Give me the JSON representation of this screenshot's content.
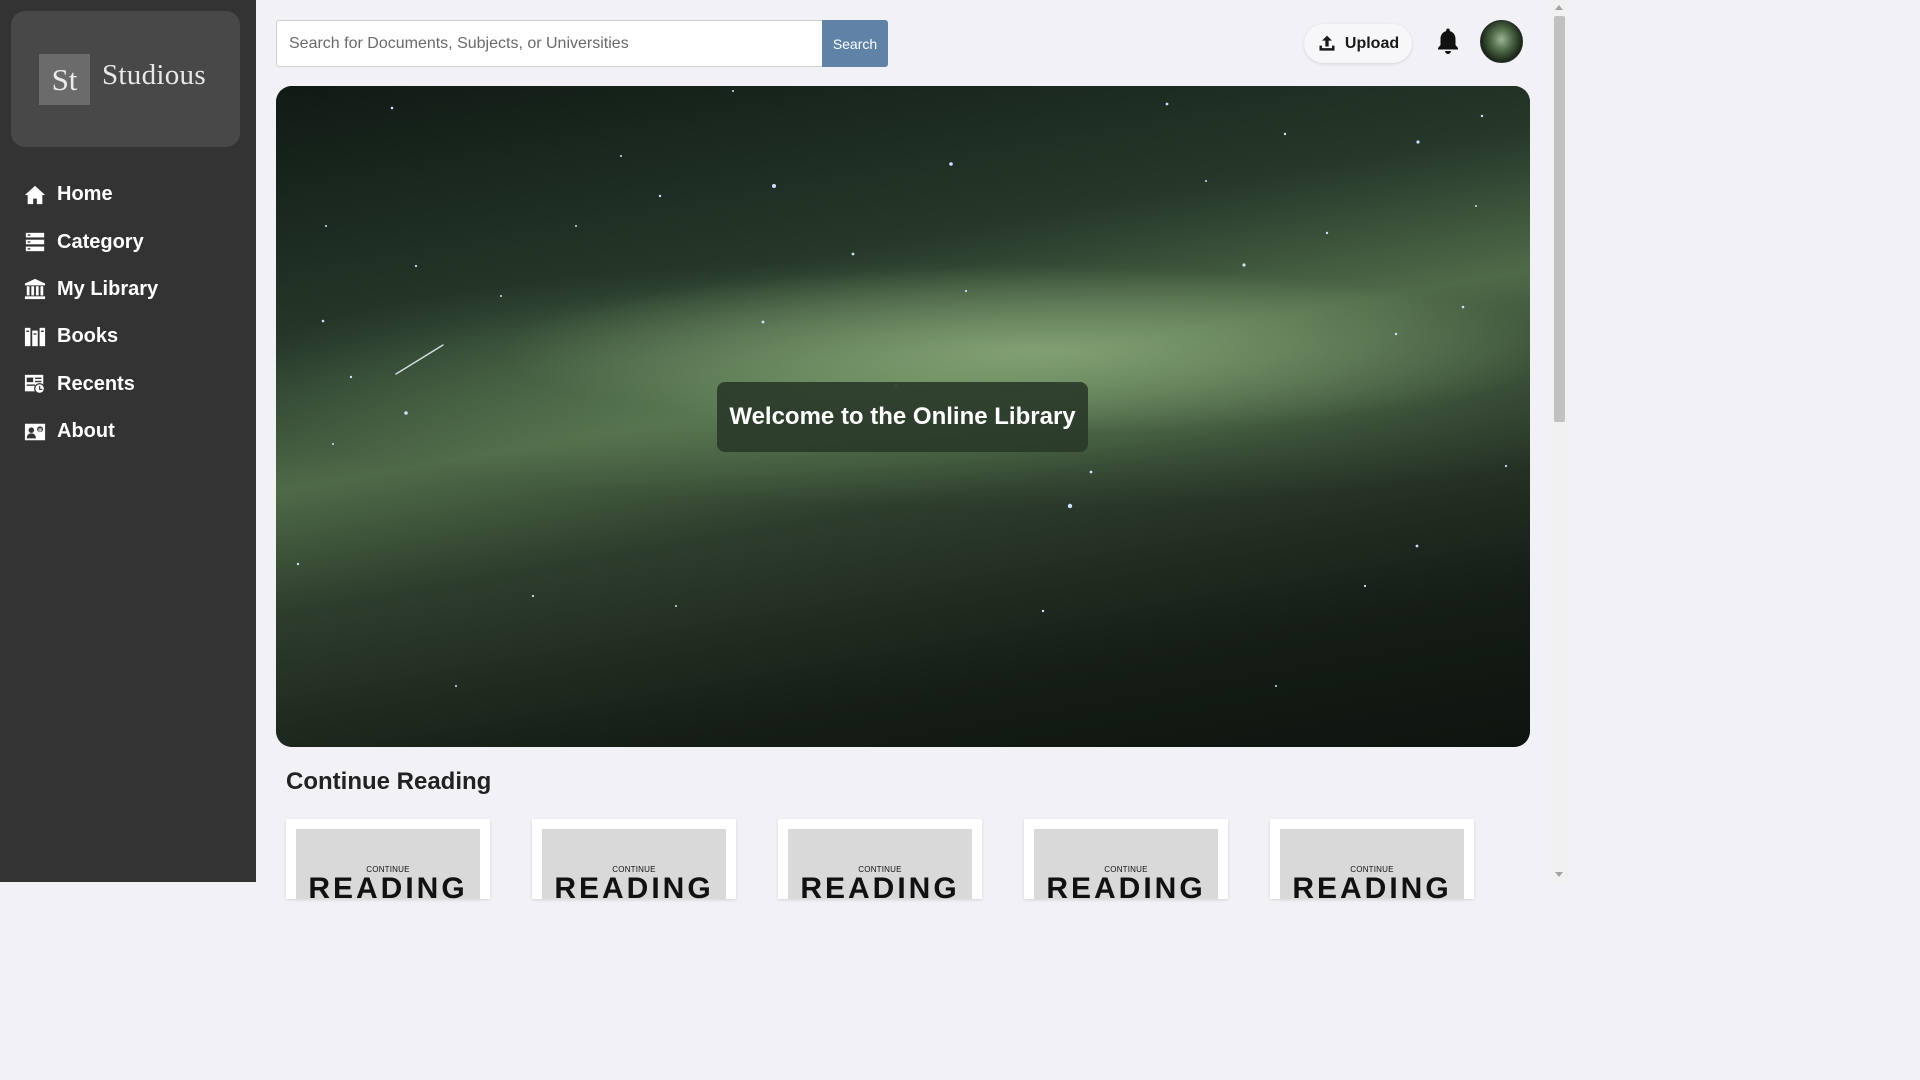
{
  "brand": {
    "mark": "St",
    "name": "Studious"
  },
  "sidebar": {
    "items": [
      {
        "label": "Home",
        "icon": "home-icon"
      },
      {
        "label": "Category",
        "icon": "category-icon"
      },
      {
        "label": "My Library",
        "icon": "library-icon"
      },
      {
        "label": "Books",
        "icon": "books-icon"
      },
      {
        "label": "Recents",
        "icon": "recents-icon"
      },
      {
        "label": "About",
        "icon": "about-icon"
      }
    ]
  },
  "search": {
    "placeholder": "Search for Documents, Subjects, or Universities",
    "value": "",
    "button_label": "Search"
  },
  "header": {
    "upload_label": "Upload",
    "upload_icon": "upload-icon",
    "bell_icon": "bell-icon",
    "avatar": "avatar"
  },
  "hero": {
    "title": "Welcome to the Online Library"
  },
  "continue_reading": {
    "title": "Continue Reading",
    "cards": [
      {
        "kicker": "CONTINUE",
        "headline": "READING"
      },
      {
        "kicker": "CONTINUE",
        "headline": "READING"
      },
      {
        "kicker": "CONTINUE",
        "headline": "READING"
      },
      {
        "kicker": "CONTINUE",
        "headline": "READING"
      },
      {
        "kicker": "CONTINUE",
        "headline": "READING"
      }
    ]
  },
  "colors": {
    "sidebar_bg": "#333333",
    "accent_search_button": "#5f82a6",
    "page_bg": "#f2f2f6"
  }
}
